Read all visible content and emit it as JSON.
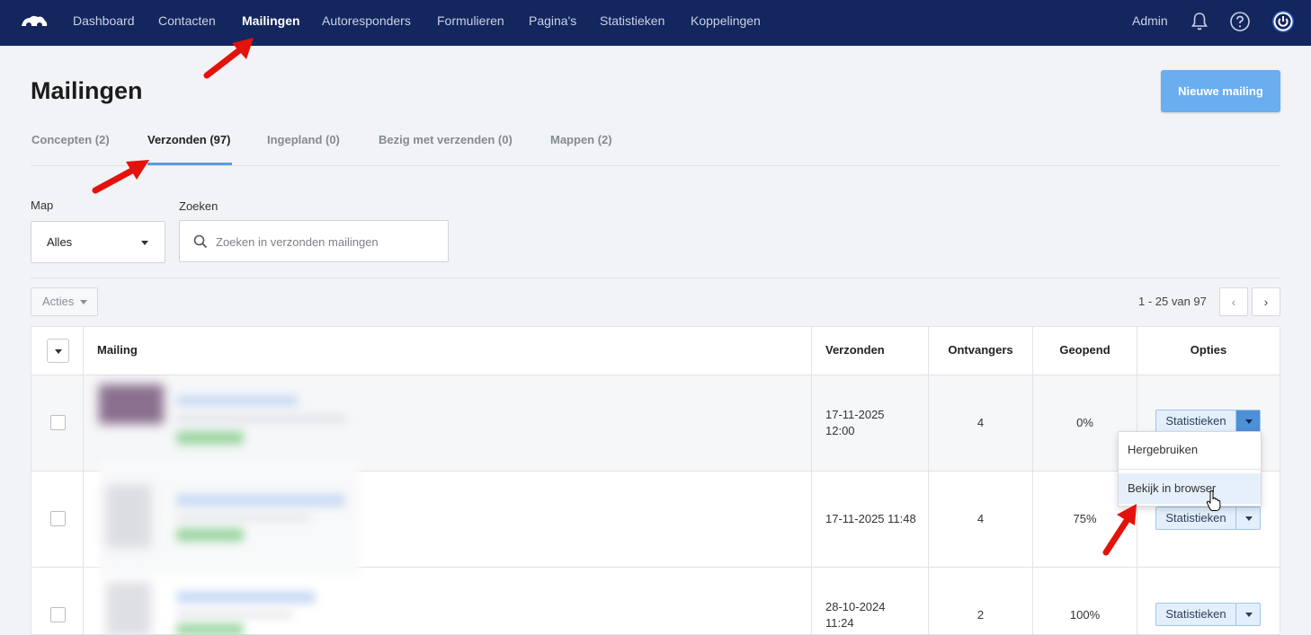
{
  "nav": {
    "items": [
      "Dashboard",
      "Contacten",
      "Mailingen",
      "Autoresponders",
      "Formulieren",
      "Pagina's",
      "Statistieken",
      "Koppelingen"
    ],
    "active": "Mailingen",
    "admin": "Admin"
  },
  "page": {
    "title": "Mailingen",
    "new_button": "Nieuwe mailing"
  },
  "tabs": [
    "Concepten (2)",
    "Verzonden (97)",
    "Ingepland (0)",
    "Bezig met verzenden (0)",
    "Mappen (2)"
  ],
  "filters": {
    "map_label": "Map",
    "map_value": "Alles",
    "search_label": "Zoeken",
    "search_placeholder": "Zoeken in verzonden mailingen"
  },
  "toolbar": {
    "acties": "Acties",
    "pager": "1 - 25 van 97",
    "prev": "‹",
    "next": "›"
  },
  "table": {
    "headers": {
      "mailing": "Mailing",
      "verzonden": "Verzonden",
      "ontvangers": "Ontvangers",
      "geopend": "Geopend",
      "opties": "Opties"
    },
    "rows": [
      {
        "date": "17-11-2025",
        "time": "12:00",
        "recipients": "4",
        "opened": "0%",
        "option": "Statistieken"
      },
      {
        "date": "17-11-2025 11:48",
        "time": "",
        "recipients": "4",
        "opened": "75%",
        "option": "Statistieken"
      },
      {
        "date": "28-10-2024",
        "time": "11:24",
        "recipients": "2",
        "opened": "100%",
        "option": "Statistieken"
      }
    ]
  },
  "dropdown": {
    "items": [
      "Hergebruiken",
      "Bekijk in browser"
    ]
  },
  "colors": {
    "nav_bg": "#13265e",
    "accent": "#5a9de0",
    "primary_button": "#6aaef0",
    "annotation_arrow": "#e3120b"
  }
}
